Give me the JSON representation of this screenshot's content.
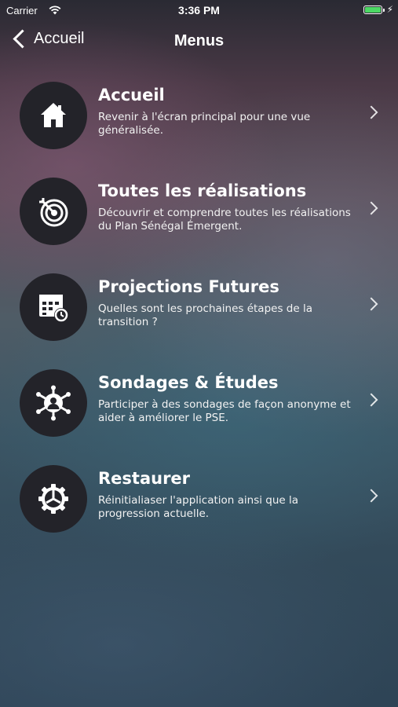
{
  "status_bar": {
    "carrier": "Carrier",
    "time": "3:36 PM",
    "battery_level": 1.0
  },
  "nav": {
    "back_label": "Accueil",
    "title": "Menus"
  },
  "menu": [
    {
      "icon": "home-icon",
      "title": "Accueil",
      "description": "Revenir à l'écran principal pour une vue généralisée."
    },
    {
      "icon": "target-icon",
      "title": "Toutes les réalisations",
      "description": "Découvrir et comprendre toutes les réalisations du Plan Sénégal Émergent."
    },
    {
      "icon": "calendar-clock-icon",
      "title": "Projections Futures",
      "description": "Quelles sont les prochaines étapes de la transition ?"
    },
    {
      "icon": "user-network-icon",
      "title": "Sondages & Études",
      "description": "Participer à des sondages de façon anonyme et aider à améliorer le PSE."
    },
    {
      "icon": "gear-icon",
      "title": "Restaurer",
      "description": "Réinitialiaser l'application ainsi que la progression actuelle."
    }
  ],
  "colors": {
    "battery": "#4cd964",
    "icon_circle": "#232329"
  }
}
